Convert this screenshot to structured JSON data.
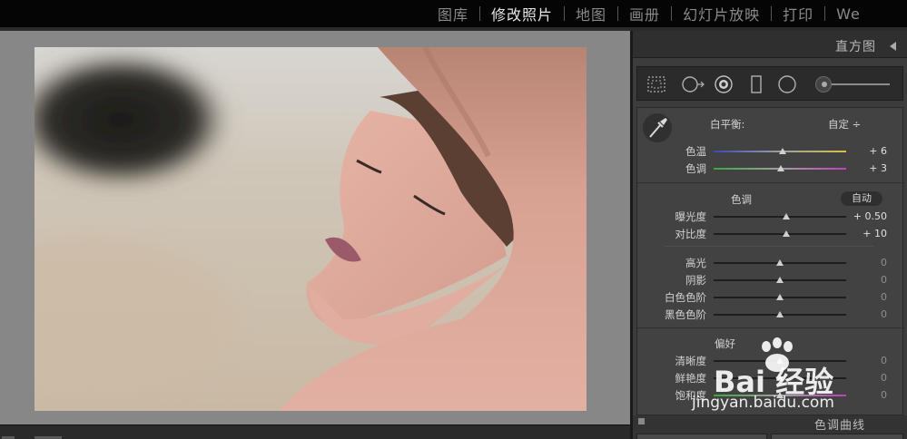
{
  "modules": [
    {
      "label": "图库",
      "active": false
    },
    {
      "label": "修改照片",
      "active": true
    },
    {
      "label": "地图",
      "active": false
    },
    {
      "label": "画册",
      "active": false
    },
    {
      "label": "幻灯片放映",
      "active": false
    },
    {
      "label": "打印",
      "active": false
    },
    {
      "label": "We",
      "active": false
    }
  ],
  "histogram": {
    "title": "直方图"
  },
  "tools": [
    "crop-overlay-icon",
    "spot-removal-icon",
    "red-eye-icon",
    "graduated-filter-icon",
    "radial-filter-icon",
    "adjustment-brush-slider"
  ],
  "basic": {
    "white_balance_label": "白平衡:",
    "white_balance_value": "自定 ÷",
    "temp": {
      "label": "色温",
      "value": "+ 6",
      "pos": 0.52
    },
    "tint": {
      "label": "色调",
      "value": "+ 3",
      "pos": 0.51
    },
    "tone_title": "色调",
    "auto_label": "自动",
    "exposure": {
      "label": "曝光度",
      "value": "+ 0.50",
      "pos": 0.55
    },
    "contrast": {
      "label": "对比度",
      "value": "+ 10",
      "pos": 0.55
    },
    "highlights": {
      "label": "高光",
      "value": "0",
      "pos": 0.5
    },
    "shadows": {
      "label": "阴影",
      "value": "0",
      "pos": 0.5
    },
    "whites": {
      "label": "白色色阶",
      "value": "0",
      "pos": 0.5
    },
    "blacks": {
      "label": "黑色色阶",
      "value": "0",
      "pos": 0.5
    },
    "presence_title": "偏好",
    "clarity": {
      "label": "清晰度",
      "value": "0",
      "pos": 0.5
    },
    "vibrance": {
      "label": "鲜艳度",
      "value": "0",
      "pos": 0.5
    },
    "saturation": {
      "label": "饱和度",
      "value": "0",
      "pos": 0.5
    }
  },
  "tone_curve": {
    "title": "色调曲线"
  },
  "watermark": {
    "brand": "Bai 经验",
    "url": "jingyan.baidu.com"
  }
}
